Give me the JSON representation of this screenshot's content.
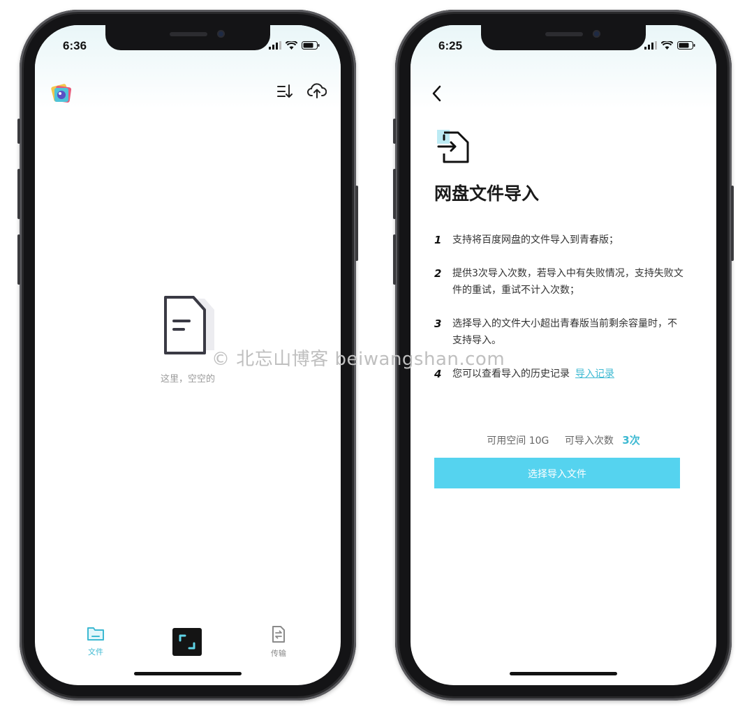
{
  "left_phone": {
    "status": {
      "time": "6:36"
    },
    "empty_state": {
      "text": "这里，空空的"
    },
    "tabbar": {
      "tabs": [
        {
          "label": "文件",
          "icon": "folder-icon",
          "active": true
        },
        {
          "label": "传输",
          "icon": "transfer-icon",
          "active": false
        }
      ],
      "center_button_icon": "scan-icon"
    },
    "toolbar_icons": [
      "sort-icon",
      "cloud-upload-icon"
    ]
  },
  "right_phone": {
    "status": {
      "time": "6:25"
    },
    "title": "网盘文件导入",
    "steps": [
      {
        "num": "1",
        "text": "支持将百度网盘的文件导入到青春版；"
      },
      {
        "num": "2",
        "text": "提供3次导入次数，若导入中有失败情况，支持失败文件的重试，重试不计入次数；"
      },
      {
        "num": "3",
        "text": "选择导入的文件大小超出青春版当前剩余容量时，不支持导入。"
      },
      {
        "num": "4",
        "text": "您可以查看导入的历史记录",
        "link": "导入记录"
      }
    ],
    "quota": {
      "space_label": "可用空间 10G",
      "count_label": "可导入次数",
      "count_value": "3次"
    },
    "primary_button": "选择导入文件"
  },
  "watermark": "© 北忘山博客 beiwangshan.com",
  "colors": {
    "accent": "#55d3ef",
    "link": "#3db9d2",
    "tab_active": "#3db9d2",
    "tab_inactive": "#888888"
  }
}
